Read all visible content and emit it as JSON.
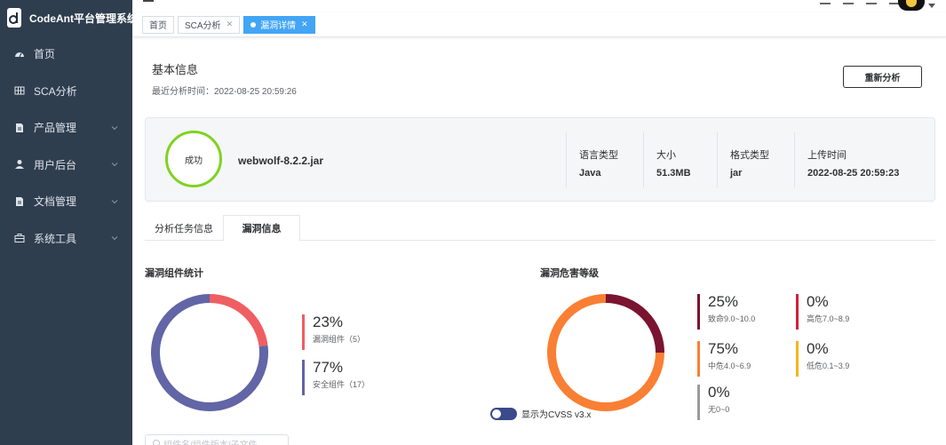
{
  "app": {
    "title": "CodeAnt平台管理系统"
  },
  "sidebar": {
    "items": [
      {
        "label": "首页",
        "icon": "dashboard-icon",
        "has_children": false
      },
      {
        "label": "SCA分析",
        "icon": "grid-icon",
        "has_children": false
      },
      {
        "label": "产品管理",
        "icon": "document-icon",
        "has_children": true
      },
      {
        "label": "用户后台",
        "icon": "user-icon",
        "has_children": true
      },
      {
        "label": "文档管理",
        "icon": "document-icon",
        "has_children": true
      },
      {
        "label": "系统工具",
        "icon": "toolbox-icon",
        "has_children": true
      }
    ]
  },
  "tabs": [
    {
      "label": "首页",
      "closable": false,
      "active": false
    },
    {
      "label": "SCA分析",
      "closable": true,
      "active": false
    },
    {
      "label": "漏洞详情",
      "closable": true,
      "active": true
    }
  ],
  "basic": {
    "title": "基本信息",
    "last_analysis": "最近分析时间：2022-08-25 20:59:26",
    "reanalyze_label": "重新分析"
  },
  "file": {
    "status": "成功",
    "name": "webwolf-8.2.2.jar",
    "columns": [
      {
        "key": "语言类型",
        "value": "Java"
      },
      {
        "key": "大小",
        "value": "51.3MB"
      },
      {
        "key": "格式类型",
        "value": "jar"
      },
      {
        "key": "上传时间",
        "value": "2022-08-25 20:59:23"
      }
    ]
  },
  "subtabs": {
    "task_info": "分析任务信息",
    "vuln_info": "漏洞信息"
  },
  "component_stats": {
    "title": "漏洞组件统计",
    "items": [
      {
        "pct": "23%",
        "label": "漏洞组件（5）",
        "color": "#ef5e62"
      },
      {
        "pct": "77%",
        "label": "安全组件（17）",
        "color": "#6265a6"
      }
    ]
  },
  "severity": {
    "title": "漏洞危害等级",
    "items": [
      {
        "pct": "25%",
        "label": "致命9.0~10.0",
        "color": "#7a1431"
      },
      {
        "pct": "0%",
        "label": "高危7.0~8.9",
        "color": "#d0213b"
      },
      {
        "pct": "75%",
        "label": "中危4.0~6.9",
        "color": "#f97f34"
      },
      {
        "pct": "0%",
        "label": "低危0.1~3.9",
        "color": "#f5b51c"
      },
      {
        "pct": "0%",
        "label": "无0~0",
        "color": "#9a9a9a"
      }
    ],
    "toggle_label": "显示为CVSS v3.x"
  },
  "search": {
    "placeholder": "组件名/组件版本/子文件..."
  },
  "chart_data": [
    {
      "type": "pie",
      "categories": [
        "漏洞组件",
        "安全组件"
      ],
      "values": [
        23,
        77
      ],
      "colors": [
        "#ef5e62",
        "#6265a6"
      ]
    },
    {
      "type": "pie",
      "categories": [
        "致命9.0~10.0",
        "高危7.0~8.9",
        "中危4.0~6.9",
        "低危0.1~3.9",
        "无0~0"
      ],
      "values": [
        25,
        0,
        75,
        0,
        0
      ],
      "colors": [
        "#7a1431",
        "#d0213b",
        "#f97f34",
        "#f5b51c",
        "#9a9a9a"
      ]
    }
  ]
}
